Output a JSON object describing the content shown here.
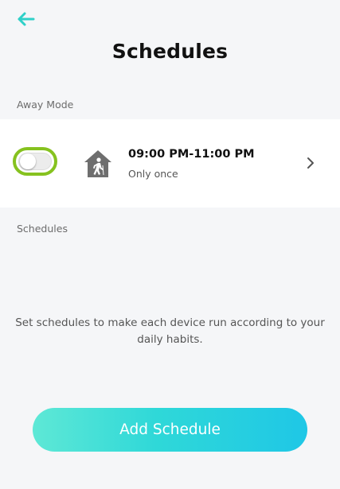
{
  "header": {
    "back_icon": "arrow-left-icon",
    "title": "Schedules"
  },
  "away_mode": {
    "section_label": "Away Mode",
    "enabled": false,
    "icon": "house-person-icon",
    "time_range": "09:00 PM-11:00 PM",
    "repeat": "Only once",
    "chevron_icon": "chevron-right-icon"
  },
  "schedules": {
    "section_label": "Schedules",
    "empty_message_line1": "Set schedules to make each device run according to your",
    "empty_message_line2": "daily habits."
  },
  "add_button": {
    "label": "Add Schedule"
  },
  "colors": {
    "accent": "#2fd8d8",
    "focus_ring": "#86c21f",
    "background": "#f5f6f8"
  }
}
